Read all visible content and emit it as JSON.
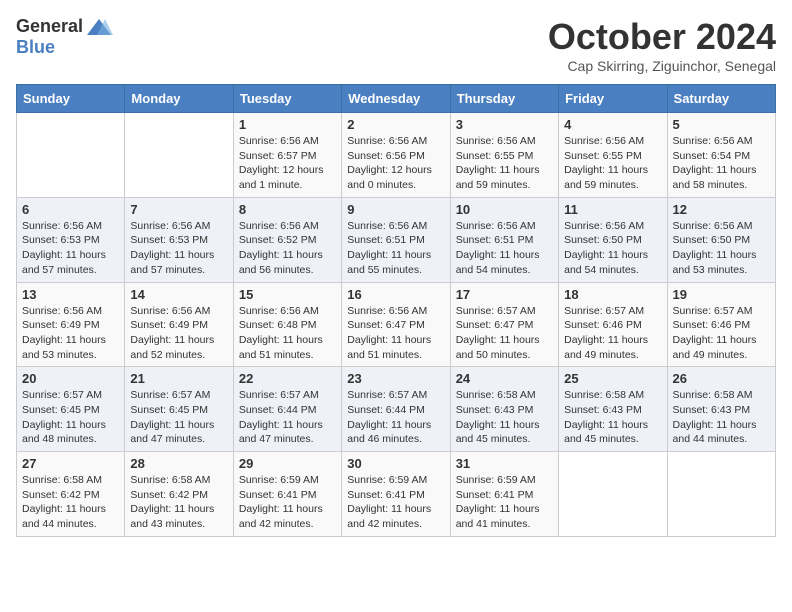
{
  "header": {
    "logo_general": "General",
    "logo_blue": "Blue",
    "month_title": "October 2024",
    "subtitle": "Cap Skirring, Ziguinchor, Senegal"
  },
  "weekdays": [
    "Sunday",
    "Monday",
    "Tuesday",
    "Wednesday",
    "Thursday",
    "Friday",
    "Saturday"
  ],
  "weeks": [
    [
      {
        "day": "",
        "info": ""
      },
      {
        "day": "",
        "info": ""
      },
      {
        "day": "1",
        "info": "Sunrise: 6:56 AM\nSunset: 6:57 PM\nDaylight: 12 hours\nand 1 minute."
      },
      {
        "day": "2",
        "info": "Sunrise: 6:56 AM\nSunset: 6:56 PM\nDaylight: 12 hours\nand 0 minutes."
      },
      {
        "day": "3",
        "info": "Sunrise: 6:56 AM\nSunset: 6:55 PM\nDaylight: 11 hours\nand 59 minutes."
      },
      {
        "day": "4",
        "info": "Sunrise: 6:56 AM\nSunset: 6:55 PM\nDaylight: 11 hours\nand 59 minutes."
      },
      {
        "day": "5",
        "info": "Sunrise: 6:56 AM\nSunset: 6:54 PM\nDaylight: 11 hours\nand 58 minutes."
      }
    ],
    [
      {
        "day": "6",
        "info": "Sunrise: 6:56 AM\nSunset: 6:53 PM\nDaylight: 11 hours\nand 57 minutes."
      },
      {
        "day": "7",
        "info": "Sunrise: 6:56 AM\nSunset: 6:53 PM\nDaylight: 11 hours\nand 57 minutes."
      },
      {
        "day": "8",
        "info": "Sunrise: 6:56 AM\nSunset: 6:52 PM\nDaylight: 11 hours\nand 56 minutes."
      },
      {
        "day": "9",
        "info": "Sunrise: 6:56 AM\nSunset: 6:51 PM\nDaylight: 11 hours\nand 55 minutes."
      },
      {
        "day": "10",
        "info": "Sunrise: 6:56 AM\nSunset: 6:51 PM\nDaylight: 11 hours\nand 54 minutes."
      },
      {
        "day": "11",
        "info": "Sunrise: 6:56 AM\nSunset: 6:50 PM\nDaylight: 11 hours\nand 54 minutes."
      },
      {
        "day": "12",
        "info": "Sunrise: 6:56 AM\nSunset: 6:50 PM\nDaylight: 11 hours\nand 53 minutes."
      }
    ],
    [
      {
        "day": "13",
        "info": "Sunrise: 6:56 AM\nSunset: 6:49 PM\nDaylight: 11 hours\nand 53 minutes."
      },
      {
        "day": "14",
        "info": "Sunrise: 6:56 AM\nSunset: 6:49 PM\nDaylight: 11 hours\nand 52 minutes."
      },
      {
        "day": "15",
        "info": "Sunrise: 6:56 AM\nSunset: 6:48 PM\nDaylight: 11 hours\nand 51 minutes."
      },
      {
        "day": "16",
        "info": "Sunrise: 6:56 AM\nSunset: 6:47 PM\nDaylight: 11 hours\nand 51 minutes."
      },
      {
        "day": "17",
        "info": "Sunrise: 6:57 AM\nSunset: 6:47 PM\nDaylight: 11 hours\nand 50 minutes."
      },
      {
        "day": "18",
        "info": "Sunrise: 6:57 AM\nSunset: 6:46 PM\nDaylight: 11 hours\nand 49 minutes."
      },
      {
        "day": "19",
        "info": "Sunrise: 6:57 AM\nSunset: 6:46 PM\nDaylight: 11 hours\nand 49 minutes."
      }
    ],
    [
      {
        "day": "20",
        "info": "Sunrise: 6:57 AM\nSunset: 6:45 PM\nDaylight: 11 hours\nand 48 minutes."
      },
      {
        "day": "21",
        "info": "Sunrise: 6:57 AM\nSunset: 6:45 PM\nDaylight: 11 hours\nand 47 minutes."
      },
      {
        "day": "22",
        "info": "Sunrise: 6:57 AM\nSunset: 6:44 PM\nDaylight: 11 hours\nand 47 minutes."
      },
      {
        "day": "23",
        "info": "Sunrise: 6:57 AM\nSunset: 6:44 PM\nDaylight: 11 hours\nand 46 minutes."
      },
      {
        "day": "24",
        "info": "Sunrise: 6:58 AM\nSunset: 6:43 PM\nDaylight: 11 hours\nand 45 minutes."
      },
      {
        "day": "25",
        "info": "Sunrise: 6:58 AM\nSunset: 6:43 PM\nDaylight: 11 hours\nand 45 minutes."
      },
      {
        "day": "26",
        "info": "Sunrise: 6:58 AM\nSunset: 6:43 PM\nDaylight: 11 hours\nand 44 minutes."
      }
    ],
    [
      {
        "day": "27",
        "info": "Sunrise: 6:58 AM\nSunset: 6:42 PM\nDaylight: 11 hours\nand 44 minutes."
      },
      {
        "day": "28",
        "info": "Sunrise: 6:58 AM\nSunset: 6:42 PM\nDaylight: 11 hours\nand 43 minutes."
      },
      {
        "day": "29",
        "info": "Sunrise: 6:59 AM\nSunset: 6:41 PM\nDaylight: 11 hours\nand 42 minutes."
      },
      {
        "day": "30",
        "info": "Sunrise: 6:59 AM\nSunset: 6:41 PM\nDaylight: 11 hours\nand 42 minutes."
      },
      {
        "day": "31",
        "info": "Sunrise: 6:59 AM\nSunset: 6:41 PM\nDaylight: 11 hours\nand 41 minutes."
      },
      {
        "day": "",
        "info": ""
      },
      {
        "day": "",
        "info": ""
      }
    ]
  ]
}
